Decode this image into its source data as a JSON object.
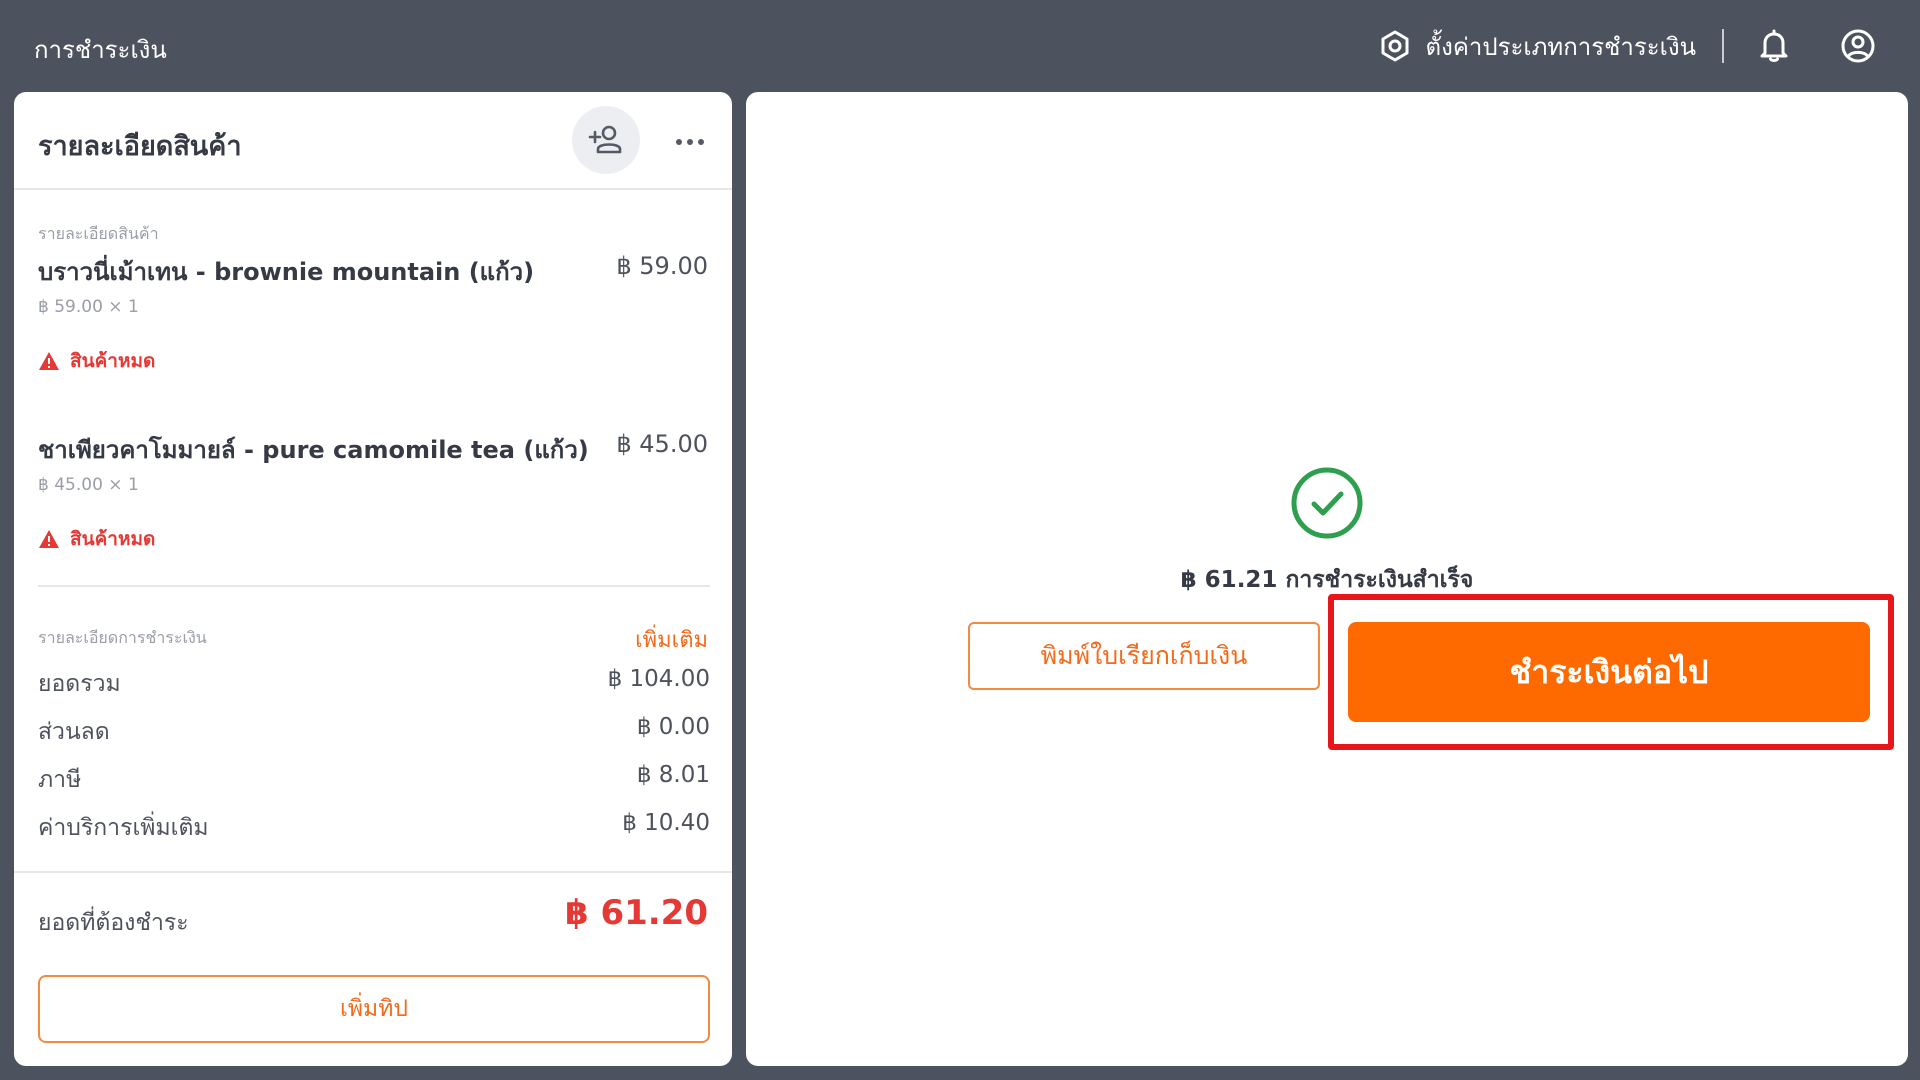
{
  "header": {
    "title": "การชำระเงิน",
    "settings_label": "ตั้งค่าประเภทการชำระเงิน"
  },
  "left_panel": {
    "title": "รายละเอียดสินค้า",
    "items_section_label": "รายละเอียดสินค้า",
    "items": [
      {
        "name": "บราวนี่เม้าเทน - brownie mountain (แก้ว)",
        "price": "฿ 59.00",
        "unit_qty": "฿ 59.00 × 1",
        "status": "สินค้าหมด"
      },
      {
        "name": "ชาเพียวคาโมมายล์ - pure camomile tea (แก้ว)",
        "price": "฿ 45.00",
        "unit_qty": "฿ 45.00 × 1",
        "status": "สินค้าหมด"
      }
    ],
    "payment_section_label": "รายละเอียดการชำระเงิน",
    "add_more_label": "เพิ่มเติม",
    "summary": [
      {
        "label": "ยอดรวม",
        "value": "฿ 104.00"
      },
      {
        "label": "ส่วนลด",
        "value": "฿ 0.00"
      },
      {
        "label": "ภาษี",
        "value": "฿ 8.01"
      },
      {
        "label": "ค่าบริการเพิ่มเติม",
        "value": "฿ 10.40"
      }
    ],
    "amount_due_label": "ยอดที่ต้องชำระ",
    "amount_due_value": "฿ 61.20",
    "add_tip_label": "เพิ่มทิป"
  },
  "right_panel": {
    "success_text": "฿ 61.21 การชำระเงินสำเร็จ",
    "print_receipt_label": "พิมพ์ใบเรียกเก็บเงิน",
    "continue_label": "ชำระเงินต่อไป"
  },
  "colors": {
    "topbar": "#4c525e",
    "accent": "#ff6a00",
    "danger": "#e53935",
    "success": "#2e9e4f",
    "highlight": "#e8161a"
  },
  "icons": {
    "settings": "gear-hexagon-icon",
    "notifications": "bell-icon",
    "account": "user-circle-icon",
    "add_customer": "add-user-icon",
    "more": "more-horizontal-icon",
    "out_of_stock": "warning-triangle-icon",
    "success": "check-circle-icon"
  }
}
